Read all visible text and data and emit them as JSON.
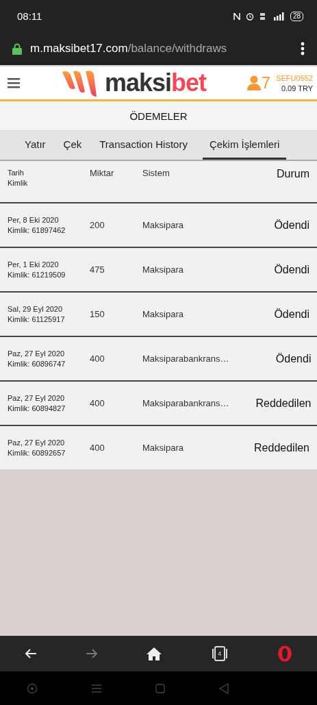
{
  "status_bar": {
    "time": "08:11",
    "battery": "28"
  },
  "address_bar": {
    "host": "m.maksibet17.com",
    "path": "/balance/withdraws"
  },
  "header": {
    "logo_main": "maksi",
    "logo_accent": "bet",
    "notifications": "7",
    "username": "SEFU0552",
    "balance": "0.09 TRY"
  },
  "page_title": "ÖDEMELER",
  "tabs": [
    {
      "label": "Yatır",
      "selected": false
    },
    {
      "label": "Çek",
      "selected": false
    },
    {
      "label": "Transaction History",
      "selected": false
    },
    {
      "label": "Çekim İşlemleri",
      "selected": true
    }
  ],
  "table": {
    "columns": [
      {
        "line1": "Tarih",
        "line2": "Kimlik"
      },
      {
        "line1": "Miktar"
      },
      {
        "line1": "Sistem"
      },
      {
        "line1": "Durum"
      }
    ],
    "rows": [
      {
        "date": "Per, 8 Eki 2020",
        "id": "Kimlik: 61897462",
        "amount": "200",
        "system": "Maksipara",
        "status": "Ödendi"
      },
      {
        "date": "Per, 1 Eki 2020",
        "id": "Kimlik: 61219509",
        "amount": "475",
        "system": "Maksipara",
        "status": "Ödendi"
      },
      {
        "date": "Sal, 29 Eyl 2020",
        "id": "Kimlik: 61125917",
        "amount": "150",
        "system": "Maksipara",
        "status": "Ödendi"
      },
      {
        "date": "Paz, 27 Eyl 2020",
        "id": "Kimlik: 60896747",
        "amount": "400",
        "system": "Maksiparabankrans…",
        "status": "Ödendi"
      },
      {
        "date": "Paz, 27 Eyl 2020",
        "id": "Kimlik: 60894827",
        "amount": "400",
        "system": "Maksiparabankrans…",
        "status": "Reddedilen"
      },
      {
        "date": "Paz, 27 Eyl 2020",
        "id": "Kimlik: 60892657",
        "amount": "400",
        "system": "Maksipara",
        "status": "Reddedilen"
      }
    ]
  },
  "browser_toolbar": {
    "tab_count": "4"
  }
}
